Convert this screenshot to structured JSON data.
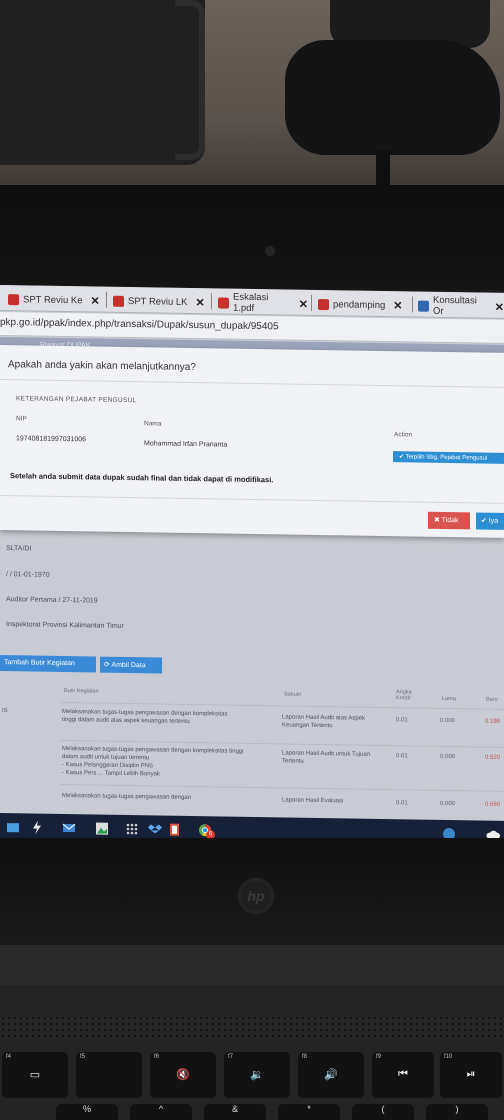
{
  "browser": {
    "tabs": [
      {
        "label": "SPT Reviu Ke"
      },
      {
        "label": "SPT Reviu LK"
      },
      {
        "label": "Eskalasi 1.pdf"
      },
      {
        "label": "pendamping"
      },
      {
        "label": "Konsultasi Or"
      }
    ],
    "close_glyph": "✕",
    "url": "pkp.go.id/ppak/index.php/transaksi/Dupak/susun_dupak/95405",
    "subnav": "Riwayat DUPAK"
  },
  "modal": {
    "question": "Apakah anda yakin akan melanjutkannya?",
    "section_heading": "KETERANGAN PEJABAT PENGUSUL",
    "nip_label": "NIP",
    "nama_label": "Nama",
    "action_label": "Action",
    "nip_value": "197408181997031006",
    "nama_value": "Mohammad Irfan Prananta",
    "select_button": "✔ Terpilih Sbg. Pejabat Pengusul",
    "warning": "Setelah anda submit data dupak sudah final dan tidak dapat di modifikasi.",
    "tidak_button": "✖ Tidak",
    "iya_button": "✔ Iya"
  },
  "page": {
    "education": "SLTA/DI",
    "birth": "/ / 01-01-1970",
    "jabatan": "Auditor Pertama / 27-11-2019",
    "unit": "Inspektorat Provinsi Kalimantan Timur",
    "btn_tambah": "Tambah Butir Kegiatan",
    "btn_ambil": "⟳ Ambil Data",
    "table": {
      "headers": [
        "Butir Kegiatan",
        "Satuan",
        "Angka Kredit",
        "Lama",
        "Baru"
      ],
      "left_marker": "IS",
      "rows": [
        {
          "butir": "Melaksanakan tugas-tugas pengawasan dengan kompleksitas tinggi dalam audit atas aspek keuangan tertentu",
          "satuan": "Laporan Hasil Audit atas Aspek Keuangan Tertentu",
          "angka": "0.01",
          "lama": "0.000",
          "baru": "0.198"
        },
        {
          "butir": "Melaksanakan tugas-tugas pengawasan dengan kompleksitas tinggi dalam audit untuk tujuan tertentu",
          "sub1": "- Kasus Pelanggaran Disiplin PNS",
          "sub2": "- Kasus Pers ... Tampil Lebih Banyak",
          "satuan": "Laporan Hasil Audit untuk Tujuan Tertentu",
          "angka": "0.01",
          "lama": "0.000",
          "baru": "0.520"
        },
        {
          "butir": "Melaksanakan tugas-tugas pengawasan dengan",
          "satuan": "Laporan Hasil Evaluasi",
          "angka": "0.01",
          "lama": "0.000",
          "baru": "0.660"
        }
      ]
    }
  },
  "taskbar": {
    "badge": "6"
  },
  "laptop": {
    "logo": "hp",
    "keys": [
      {
        "fn": "f4",
        "sym": "▭"
      },
      {
        "fn": "f5",
        "sym": ""
      },
      {
        "fn": "f6",
        "sym": "🔇"
      },
      {
        "fn": "f7",
        "sym": "🔉"
      },
      {
        "fn": "f8",
        "sym": "🔊"
      },
      {
        "fn": "f9",
        "sym": "⏮"
      },
      {
        "fn": "f10",
        "sym": "⏯"
      }
    ],
    "lower_keys": [
      "%",
      "^",
      "&",
      "*",
      "(",
      ")"
    ]
  },
  "colors": {
    "accent_blue": "#2d8fd3",
    "danger_red": "#d9534f",
    "taskbar": "#162037"
  }
}
